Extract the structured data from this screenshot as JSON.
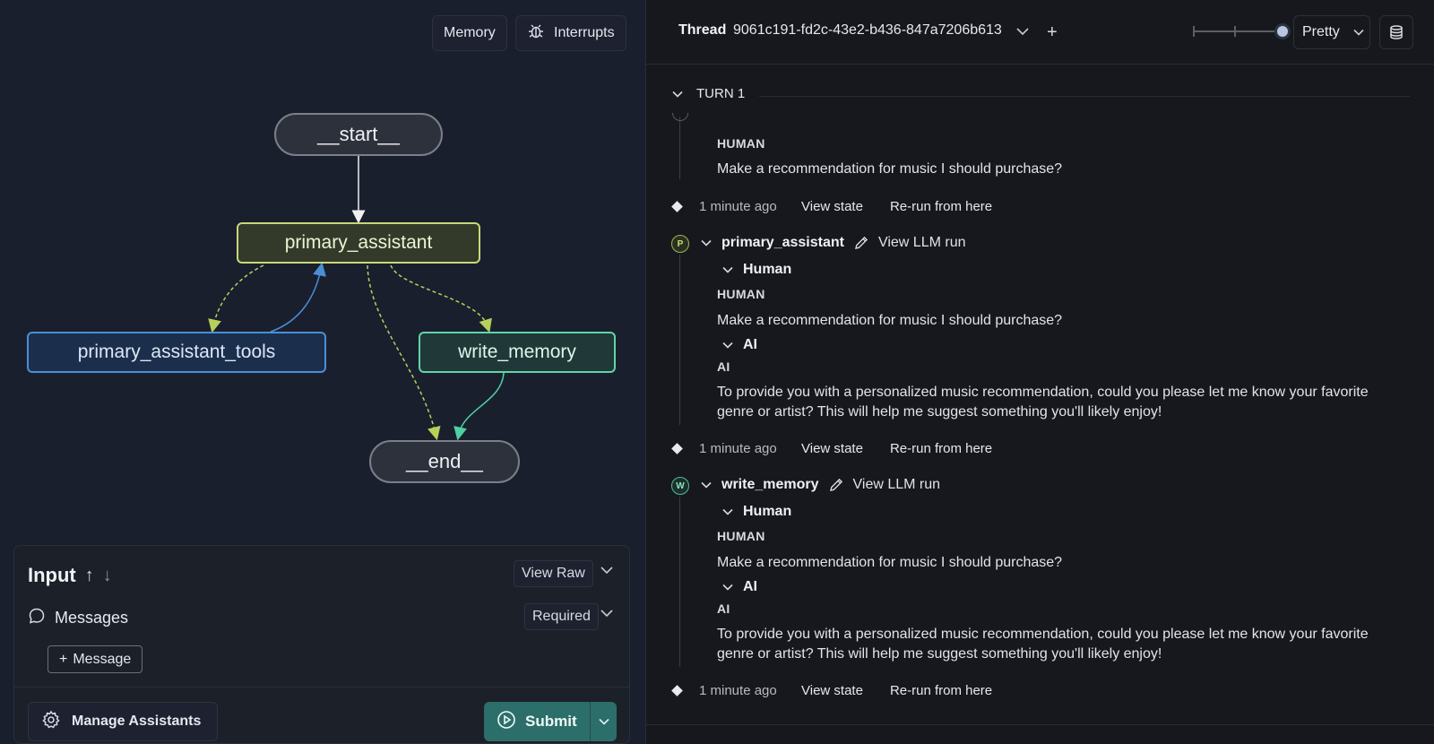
{
  "graph": {
    "topbar": {
      "memory": "Memory",
      "interrupts": "Interrupts"
    },
    "nodes": {
      "start": "__start__",
      "primary": "primary_assistant",
      "tools": "primary_assistant_tools",
      "write": "write_memory",
      "end": "__end__"
    },
    "colors": {
      "primary": "#c8d878",
      "tools": "#4a8fd6",
      "write": "#5fd6a8"
    }
  },
  "input": {
    "title": "Input",
    "view_raw": "View Raw",
    "messages_label": "Messages",
    "required": "Required",
    "add_message": "Message",
    "manage_assistants": "Manage Assistants",
    "submit": "Submit"
  },
  "thread": {
    "label": "Thread",
    "id": "9061c191-fd2c-43e2-b436-847a7206b613",
    "view_mode": "Pretty"
  },
  "turn": {
    "label": "TURN 1",
    "first": {
      "role": "HUMAN",
      "content": "Make a recommendation for music I should purchase?",
      "time": "1 minute ago",
      "view_state": "View state",
      "rerun": "Re-run from here"
    },
    "steps": [
      {
        "badge": "P",
        "name": "primary_assistant",
        "view_llm": "View LLM run",
        "human_label": "Human",
        "human_role": "HUMAN",
        "human_text": "Make a recommendation for music I should purchase?",
        "ai_label": "AI",
        "ai_role": "AI",
        "ai_text": "To provide you with a personalized music recommendation, could you please let me know your favorite genre or artist? This will help me suggest something you'll likely enjoy!",
        "time": "1 minute ago",
        "view_state": "View state",
        "rerun": "Re-run from here"
      },
      {
        "badge": "W",
        "name": "write_memory",
        "view_llm": "View LLM run",
        "human_label": "Human",
        "human_role": "HUMAN",
        "human_text": "Make a recommendation for music I should purchase?",
        "ai_label": "AI",
        "ai_role": "AI",
        "ai_text": "To provide you with a personalized music recommendation, could you please let me know your favorite genre or artist? This will help me suggest something you'll likely enjoy!",
        "time": "1 minute ago",
        "view_state": "View state",
        "rerun": "Re-run from here"
      }
    ]
  }
}
